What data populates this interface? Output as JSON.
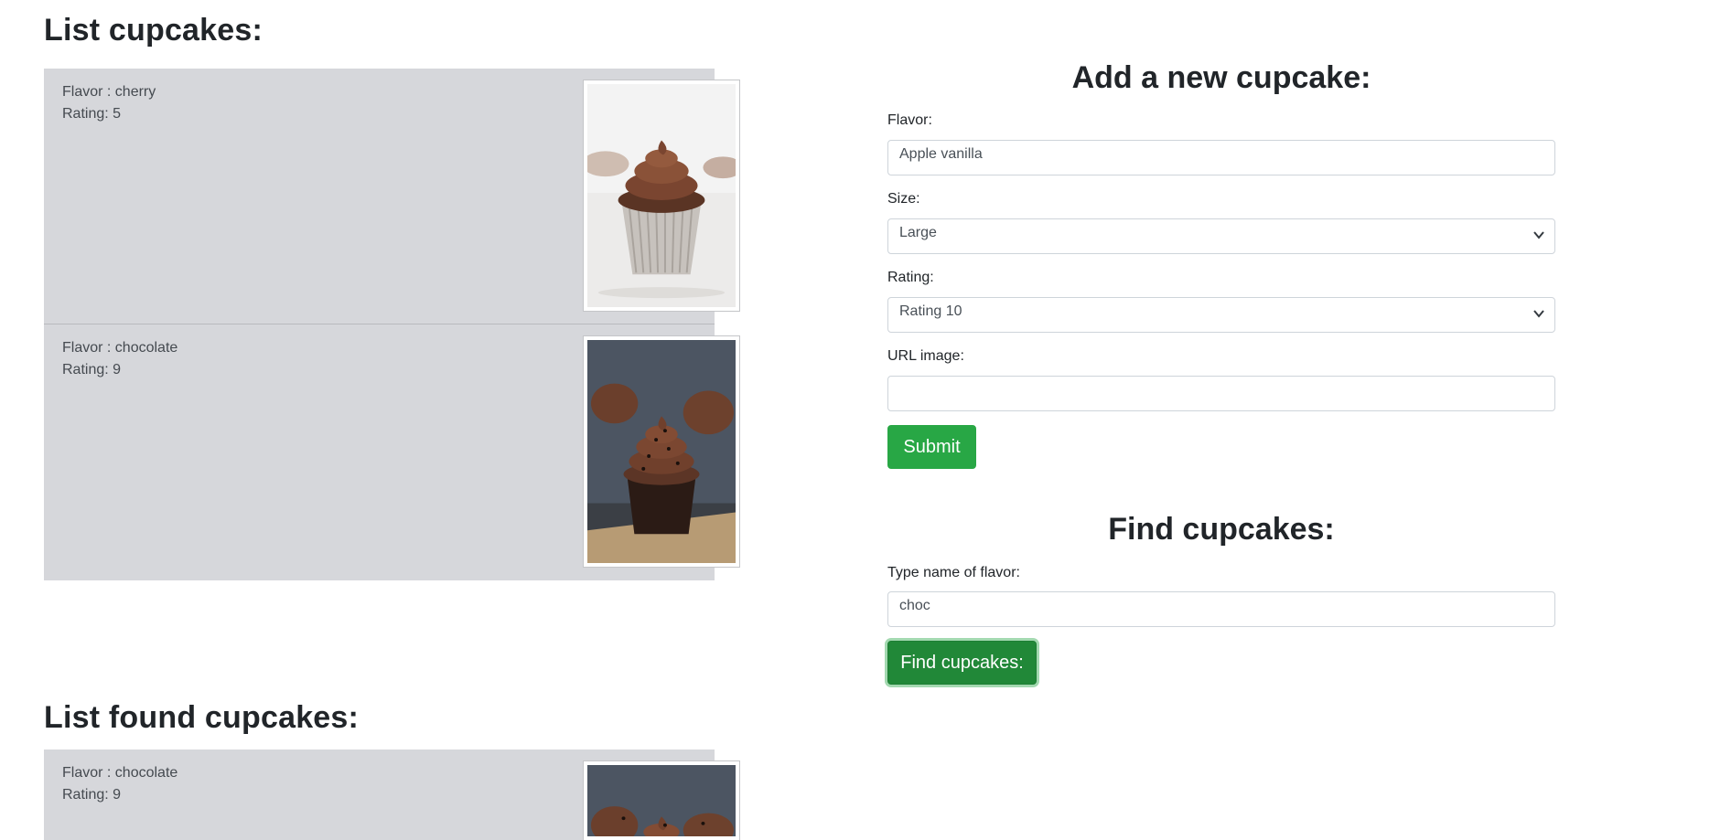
{
  "list_section": {
    "title": "List cupcakes:",
    "items": [
      {
        "flavor": "Flavor : cherry",
        "rating": "Rating: 5",
        "image": "cupcake-chocolate-frosting-photo"
      },
      {
        "flavor": "Flavor : chocolate",
        "rating": "Rating: 9",
        "image": "cupcake-chocolate-sprinkles-photo"
      }
    ]
  },
  "add_form": {
    "title": "Add a new cupcake:",
    "flavor_label": "Flavor:",
    "flavor_value": "Apple vanilla",
    "size_label": "Size:",
    "size_value": "Large",
    "rating_label": "Rating:",
    "rating_value": "Rating 10",
    "url_label": "URL image:",
    "url_value": "",
    "submit_label": "Submit"
  },
  "find_form": {
    "title": "Find cupcakes:",
    "flavor_label": "Type name of flavor:",
    "flavor_value": "choc",
    "button_label": "Find cupcakes:"
  },
  "found_section": {
    "title": "List found cupcakes:",
    "items": [
      {
        "flavor": "Flavor : chocolate",
        "rating": "Rating: 9",
        "image": "cupcake-chocolate-sprinkles-photo"
      }
    ]
  },
  "colors": {
    "list_background": "#d6d7db",
    "button_green": "#28a745",
    "button_green_active": "#218838"
  }
}
